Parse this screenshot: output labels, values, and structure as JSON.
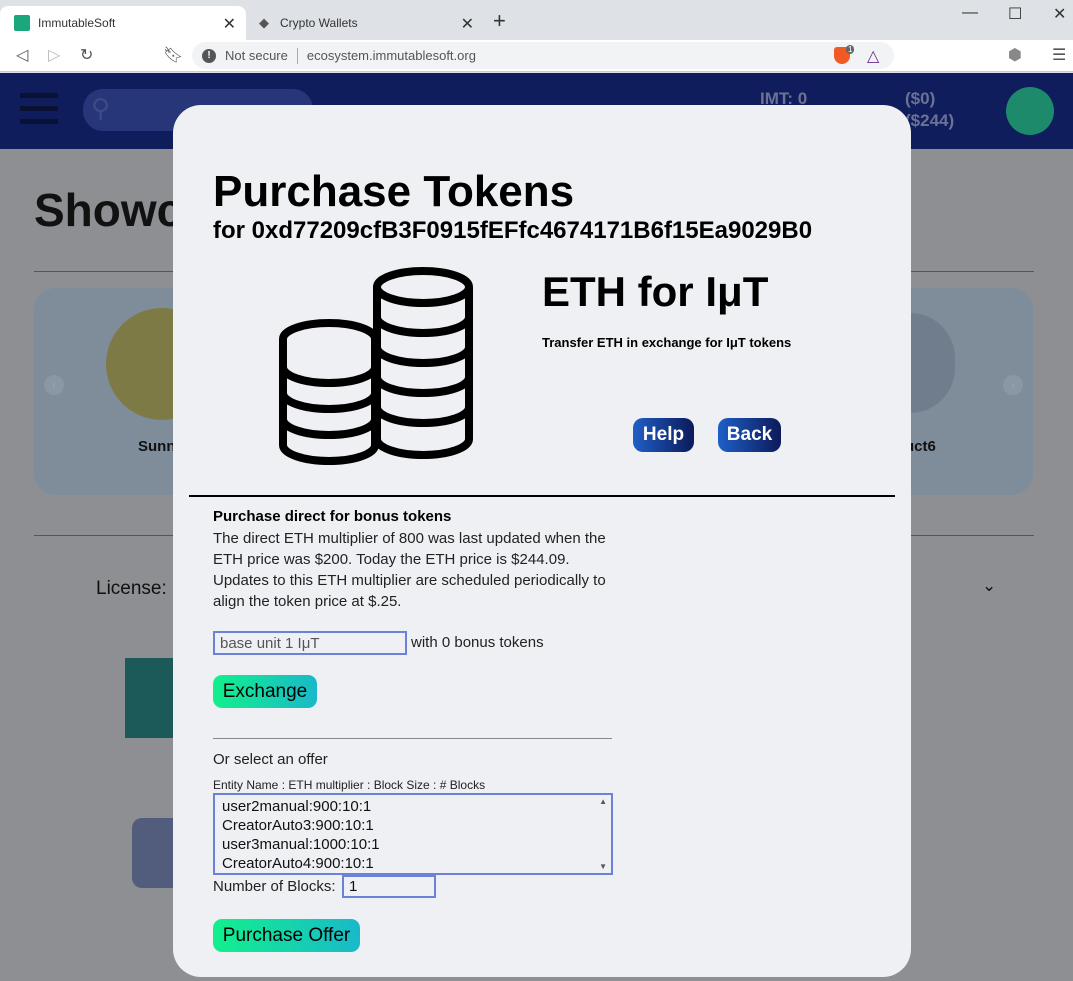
{
  "browser": {
    "tabs": [
      {
        "label": "ImmutableSoft",
        "active": true
      },
      {
        "label": "Crypto Wallets",
        "active": false
      }
    ],
    "security_label": "Not secure",
    "url": "ecosystem.immutablesoft.org",
    "brave_badge": "1"
  },
  "page": {
    "header": {
      "imt_balance": "IMT: 0",
      "usd_balance": "($0)",
      "eth_value": "($244)"
    },
    "showcase_title": "Showc",
    "carousel": {
      "left_label": "Sunn",
      "right_label": "uct6"
    },
    "license_label": "License:"
  },
  "modal": {
    "title": "Purchase Tokens",
    "address_line": "for 0xd77209cfB3F0915fEFfc4674171B6f15Ea9029B0",
    "subtitle": "ETH for IμT",
    "description": "Transfer ETH in exchange for IμT tokens",
    "help_label": "Help",
    "back_label": "Back",
    "direct": {
      "title": "Purchase direct for bonus tokens",
      "text": "The direct ETH multiplier of 800 was last updated when the ETH price was $200. Today the ETH price is $244.09. Updates to this ETH multiplier are scheduled periodically to align the token price at $.25.",
      "amount_value": "base unit 1 IμT",
      "bonus_text": "with 0 bonus tokens",
      "exchange_label": "Exchange"
    },
    "offers": {
      "heading": "Or select an offer",
      "column_header": "Entity Name : ETH multiplier : Block Size : # Blocks",
      "items": [
        "user2manual:900:10:1",
        "CreatorAuto3:900:10:1",
        "user3manual:1000:10:1",
        "CreatorAuto4:900:10:1"
      ],
      "blocks_label": "Number of Blocks:",
      "blocks_value": "1",
      "purchase_label": "Purchase Offer"
    }
  },
  "colors": {
    "header_bg": "#0f1d5c",
    "modal_bg": "#eef0f3",
    "dark_button": "#0c1a5a",
    "green_button": "#12f08c"
  }
}
